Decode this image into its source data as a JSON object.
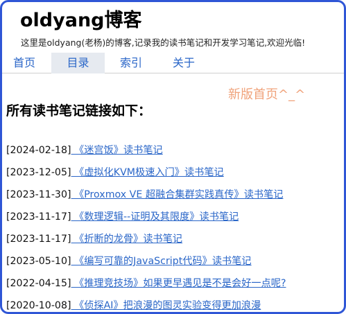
{
  "header": {
    "title": "oldyang博客",
    "description": "这里是oldyang(老杨)的博客,记录我的读书笔记和开发学习笔记,欢迎光临!"
  },
  "nav": {
    "items": [
      {
        "label": "首页"
      },
      {
        "label": "目录",
        "active": true
      },
      {
        "label": "索引"
      },
      {
        "label": "关于"
      }
    ]
  },
  "new_home_link": "新版首页^_^",
  "main": {
    "title": "所有读书笔记链接如下：",
    "notes": [
      {
        "date": "[2024-02-18]",
        "title": " 《迷宫饭》读书笔记"
      },
      {
        "date": "[2023-12-05]",
        "title": " 《虚拟化KVM极速入门》读书笔记"
      },
      {
        "date": "[2023-11-30]",
        "title": " 《Proxmox VE 超融合集群实践真传》读书笔记"
      },
      {
        "date": "[2023-11-17]",
        "title": " 《数理逻辑--证明及其限度》读书笔记"
      },
      {
        "date": "[2023-11-17]",
        "title": " 《折断的龙骨》读书笔记"
      },
      {
        "date": "[2023-05-10]",
        "title": " 《编写可靠的JavaScript代码》读书笔记"
      },
      {
        "date": "[2022-04-15]",
        "title": " 《推理竞技场》如果更早遇见是不是会好一点呢?"
      },
      {
        "date": "[2020-10-08]",
        "title": " 《侦探AI》把浪漫的图灵实验变得更加浪漫"
      }
    ]
  },
  "colors": {
    "link": "#2a66c8",
    "accent_orange": "#f0a27a",
    "frame_border": "#2f56d6",
    "nav_active_bg": "#e6eaf0"
  }
}
